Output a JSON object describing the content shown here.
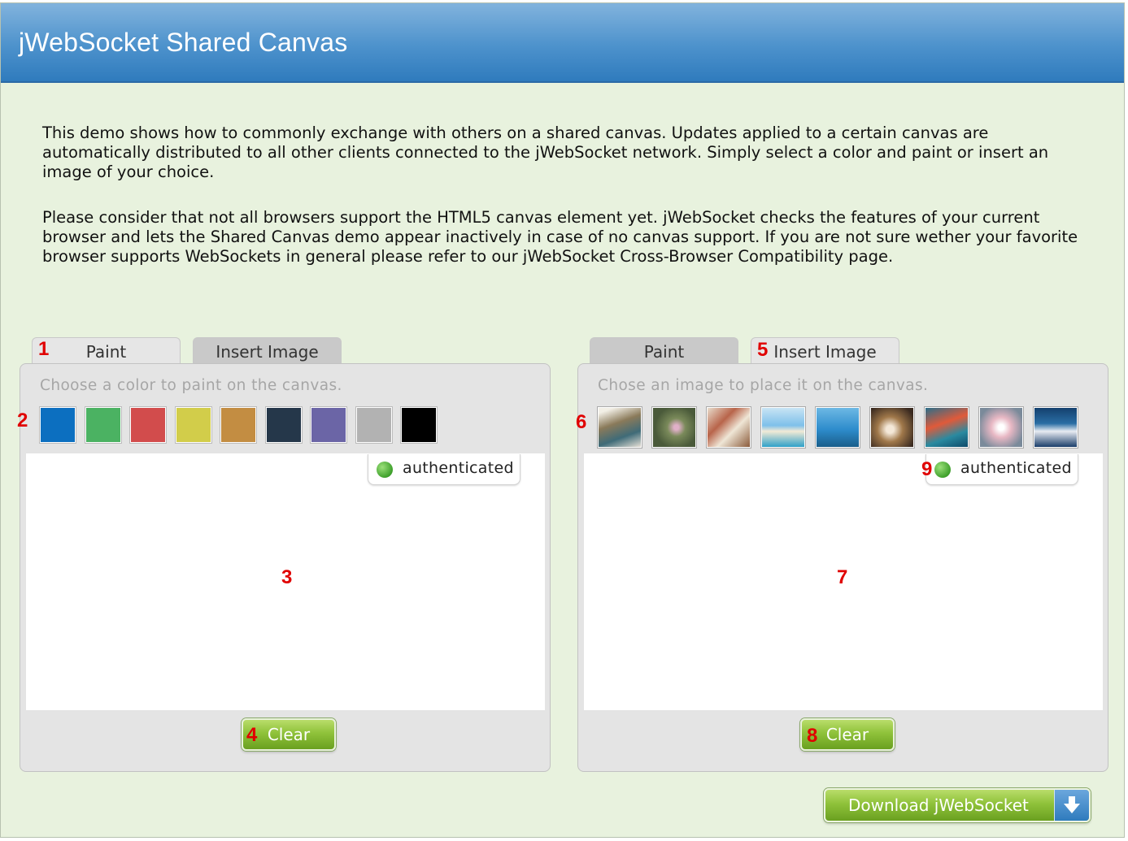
{
  "header": {
    "title": "jWebSocket Shared Canvas"
  },
  "description": {
    "p1": "This demo shows how to commonly exchange with others on a shared canvas. Updates applied to a certain canvas are automatically distributed to all other clients connected to the jWebSocket network. Simply select a color and paint or insert an image of your choice.",
    "p2": "Please consider that not all browsers support the HTML5 canvas element yet. jWebSocket checks the features of your current browser and lets the Shared Canvas demo appear inactively in case of no canvas support. If you are not sure wether your favorite browser supports WebSockets in general please refer to our jWebSocket Cross-Browser Compatibility page."
  },
  "left_panel": {
    "tabs": {
      "paint": "Paint",
      "insert_image": "Insert Image"
    },
    "active_tab": "paint",
    "hint": "Choose a color to paint on the canvas.",
    "colors": [
      "#0c6fc0",
      "#4bb262",
      "#d24c4c",
      "#d2cd4a",
      "#c38d42",
      "#25374a",
      "#6b65a6",
      "#b2b2b2",
      "#000000"
    ],
    "status": "authenticated",
    "clear_label": "Clear"
  },
  "right_panel": {
    "tabs": {
      "paint": "Paint",
      "insert_image": "Insert Image"
    },
    "active_tab": "insert_image",
    "hint": "Chose an image to place it on the canvas.",
    "images": [
      "image-1",
      "image-2",
      "image-3",
      "image-4",
      "image-5",
      "image-6",
      "image-7",
      "image-8",
      "image-9"
    ],
    "status": "authenticated",
    "clear_label": "Clear"
  },
  "download_label": "Download jWebSocket",
  "markers": [
    "1",
    "2",
    "3",
    "4",
    "5",
    "6",
    "7",
    "8",
    "9"
  ]
}
